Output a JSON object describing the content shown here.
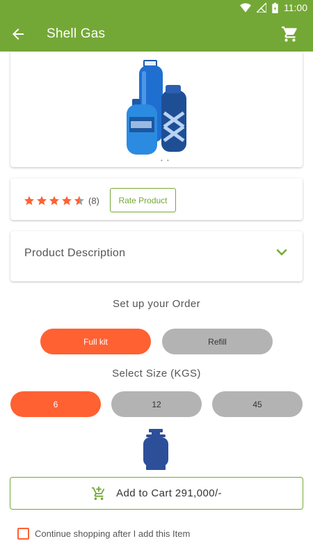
{
  "status_bar": {
    "time": "11:00",
    "battery_glyph": "battery-charging-icon",
    "wifi_glyph": "wifi-icon",
    "signal_glyph": "no-signal-icon"
  },
  "app_bar": {
    "title": "Shell Gas",
    "back_icon": "arrow-back-icon",
    "cart_icon": "shopping-cart-icon"
  },
  "product": {
    "image_alt_icon": "gas-cylinders-image",
    "rating": {
      "value": 4.5,
      "max": 5,
      "count_label": "(8)"
    },
    "rate_button_label": "Rate Product",
    "description_title": "Product Description"
  },
  "order": {
    "heading": "Set up your Order",
    "options": [
      {
        "label": "Full kit",
        "selected": true
      },
      {
        "label": "Refill",
        "selected": false
      }
    ],
    "size_heading": "Select Size (KGS)",
    "sizes": [
      {
        "label": "6",
        "selected": true
      },
      {
        "label": "12",
        "selected": false
      },
      {
        "label": "45",
        "selected": false
      }
    ]
  },
  "cart": {
    "add_label": "Add to Cart 291,000/-",
    "icon": "add-shopping-cart-icon"
  },
  "continue_checkbox": {
    "label": "Continue shopping after I add this Item",
    "checked": false
  },
  "colors": {
    "primary": "#74a836",
    "accent": "#ff6132",
    "inactive": "#b3b3b3",
    "cylinder": "#2d4f9a"
  }
}
